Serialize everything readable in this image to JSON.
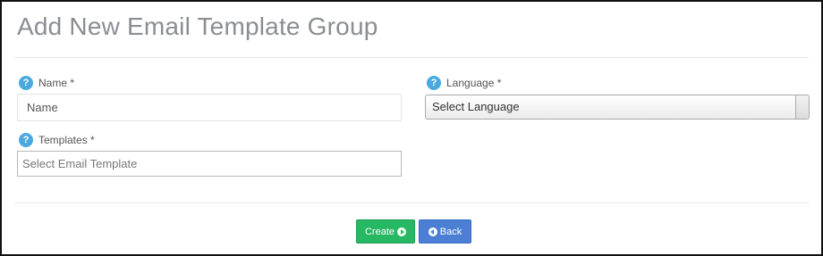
{
  "form": {
    "title": "Add New Email Template Group",
    "name": {
      "label": "Name *",
      "placeholder": "Name",
      "value": ""
    },
    "language": {
      "label": "Language *",
      "selected": "Select Language"
    },
    "templates": {
      "label": "Templates *",
      "placeholder": "Select Email Template",
      "value": ""
    },
    "help_icon": "question-mark-circle-icon",
    "help_icon_glyph": "?",
    "help_icon_color": "#4aaadf"
  },
  "actions": {
    "create_label": "Create",
    "create_icon": "arrow-circle-right-icon",
    "create_color": "#26b863",
    "back_label": "Back",
    "back_icon": "arrow-circle-left-icon",
    "back_color": "#4b7fd4"
  }
}
